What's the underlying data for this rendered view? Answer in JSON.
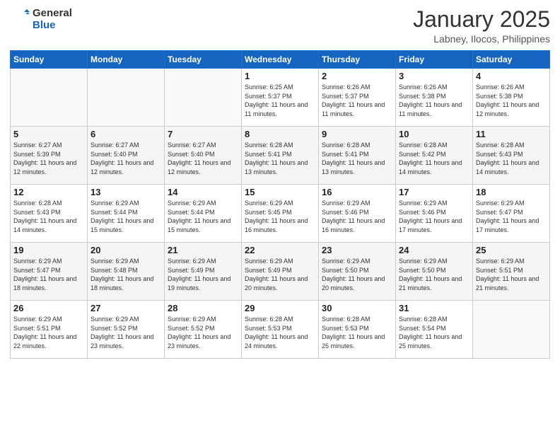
{
  "header": {
    "logo_line1": "General",
    "logo_line2": "Blue",
    "month": "January 2025",
    "location": "Labney, Ilocos, Philippines"
  },
  "weekdays": [
    "Sunday",
    "Monday",
    "Tuesday",
    "Wednesday",
    "Thursday",
    "Friday",
    "Saturday"
  ],
  "weeks": [
    [
      {
        "day": "",
        "info": ""
      },
      {
        "day": "",
        "info": ""
      },
      {
        "day": "",
        "info": ""
      },
      {
        "day": "1",
        "info": "Sunrise: 6:25 AM\nSunset: 5:37 PM\nDaylight: 11 hours and 11 minutes."
      },
      {
        "day": "2",
        "info": "Sunrise: 6:26 AM\nSunset: 5:37 PM\nDaylight: 11 hours and 11 minutes."
      },
      {
        "day": "3",
        "info": "Sunrise: 6:26 AM\nSunset: 5:38 PM\nDaylight: 11 hours and 11 minutes."
      },
      {
        "day": "4",
        "info": "Sunrise: 6:26 AM\nSunset: 5:38 PM\nDaylight: 11 hours and 12 minutes."
      }
    ],
    [
      {
        "day": "5",
        "info": "Sunrise: 6:27 AM\nSunset: 5:39 PM\nDaylight: 11 hours and 12 minutes."
      },
      {
        "day": "6",
        "info": "Sunrise: 6:27 AM\nSunset: 5:40 PM\nDaylight: 11 hours and 12 minutes."
      },
      {
        "day": "7",
        "info": "Sunrise: 6:27 AM\nSunset: 5:40 PM\nDaylight: 11 hours and 12 minutes."
      },
      {
        "day": "8",
        "info": "Sunrise: 6:28 AM\nSunset: 5:41 PM\nDaylight: 11 hours and 13 minutes."
      },
      {
        "day": "9",
        "info": "Sunrise: 6:28 AM\nSunset: 5:41 PM\nDaylight: 11 hours and 13 minutes."
      },
      {
        "day": "10",
        "info": "Sunrise: 6:28 AM\nSunset: 5:42 PM\nDaylight: 11 hours and 14 minutes."
      },
      {
        "day": "11",
        "info": "Sunrise: 6:28 AM\nSunset: 5:43 PM\nDaylight: 11 hours and 14 minutes."
      }
    ],
    [
      {
        "day": "12",
        "info": "Sunrise: 6:28 AM\nSunset: 5:43 PM\nDaylight: 11 hours and 14 minutes."
      },
      {
        "day": "13",
        "info": "Sunrise: 6:29 AM\nSunset: 5:44 PM\nDaylight: 11 hours and 15 minutes."
      },
      {
        "day": "14",
        "info": "Sunrise: 6:29 AM\nSunset: 5:44 PM\nDaylight: 11 hours and 15 minutes."
      },
      {
        "day": "15",
        "info": "Sunrise: 6:29 AM\nSunset: 5:45 PM\nDaylight: 11 hours and 16 minutes."
      },
      {
        "day": "16",
        "info": "Sunrise: 6:29 AM\nSunset: 5:46 PM\nDaylight: 11 hours and 16 minutes."
      },
      {
        "day": "17",
        "info": "Sunrise: 6:29 AM\nSunset: 5:46 PM\nDaylight: 11 hours and 17 minutes."
      },
      {
        "day": "18",
        "info": "Sunrise: 6:29 AM\nSunset: 5:47 PM\nDaylight: 11 hours and 17 minutes."
      }
    ],
    [
      {
        "day": "19",
        "info": "Sunrise: 6:29 AM\nSunset: 5:47 PM\nDaylight: 11 hours and 18 minutes."
      },
      {
        "day": "20",
        "info": "Sunrise: 6:29 AM\nSunset: 5:48 PM\nDaylight: 11 hours and 18 minutes."
      },
      {
        "day": "21",
        "info": "Sunrise: 6:29 AM\nSunset: 5:49 PM\nDaylight: 11 hours and 19 minutes."
      },
      {
        "day": "22",
        "info": "Sunrise: 6:29 AM\nSunset: 5:49 PM\nDaylight: 11 hours and 20 minutes."
      },
      {
        "day": "23",
        "info": "Sunrise: 6:29 AM\nSunset: 5:50 PM\nDaylight: 11 hours and 20 minutes."
      },
      {
        "day": "24",
        "info": "Sunrise: 6:29 AM\nSunset: 5:50 PM\nDaylight: 11 hours and 21 minutes."
      },
      {
        "day": "25",
        "info": "Sunrise: 6:29 AM\nSunset: 5:51 PM\nDaylight: 11 hours and 21 minutes."
      }
    ],
    [
      {
        "day": "26",
        "info": "Sunrise: 6:29 AM\nSunset: 5:51 PM\nDaylight: 11 hours and 22 minutes."
      },
      {
        "day": "27",
        "info": "Sunrise: 6:29 AM\nSunset: 5:52 PM\nDaylight: 11 hours and 23 minutes."
      },
      {
        "day": "28",
        "info": "Sunrise: 6:29 AM\nSunset: 5:52 PM\nDaylight: 11 hours and 23 minutes."
      },
      {
        "day": "29",
        "info": "Sunrise: 6:28 AM\nSunset: 5:53 PM\nDaylight: 11 hours and 24 minutes."
      },
      {
        "day": "30",
        "info": "Sunrise: 6:28 AM\nSunset: 5:53 PM\nDaylight: 11 hours and 25 minutes."
      },
      {
        "day": "31",
        "info": "Sunrise: 6:28 AM\nSunset: 5:54 PM\nDaylight: 11 hours and 25 minutes."
      },
      {
        "day": "",
        "info": ""
      }
    ]
  ]
}
